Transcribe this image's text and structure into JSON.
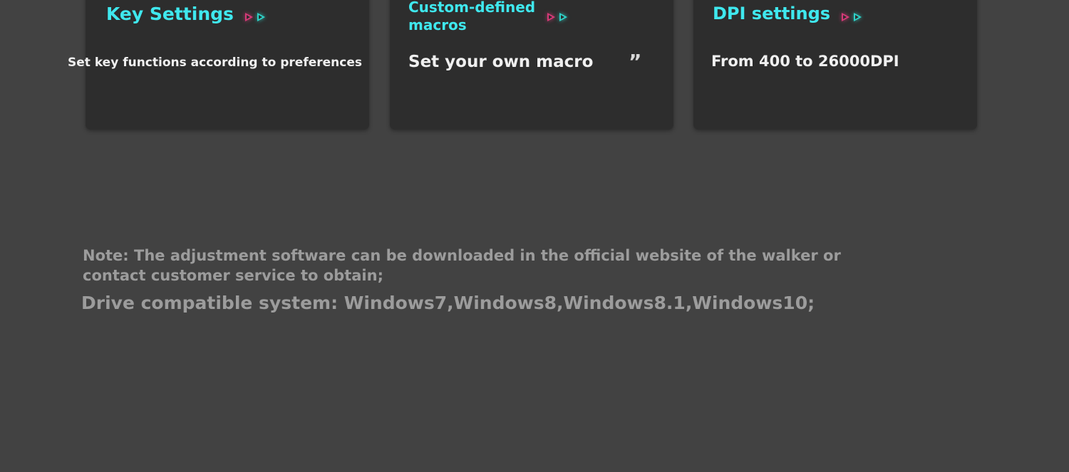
{
  "cards": [
    {
      "title": "Key Settings",
      "description": "Set key functions according to preferences"
    },
    {
      "title": "Custom-defined macros",
      "description": "Set your own macro",
      "quote": "”"
    },
    {
      "title": "DPI settings",
      "description": "From 400 to 26000DPI"
    }
  ],
  "note": "Note: The adjustment software can be downloaded in the official website of the walker or contact customer service to obtain;",
  "compat": "Drive compatible system: Windows7,Windows8,Windows8.1,Windows10;",
  "colors": {
    "background": "#424242",
    "card": "#2d2d2d",
    "accent": "#3fe8ee",
    "arrow_red": "#d63a78",
    "arrow_cyan": "#2ed3c8"
  }
}
